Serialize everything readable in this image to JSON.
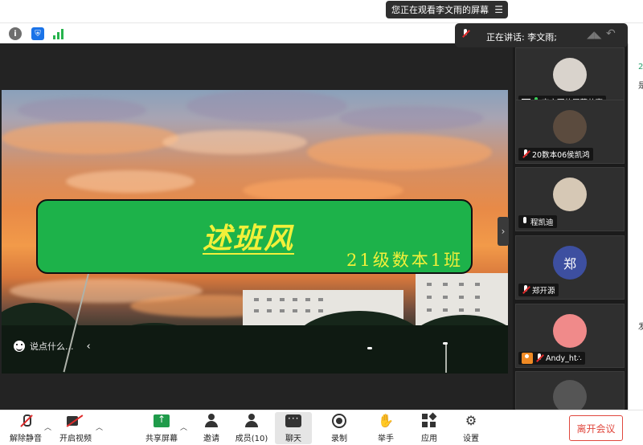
{
  "banner": {
    "viewing_text": "您正在观看李文雨的屏幕",
    "menu_icon": "hamburger-icon"
  },
  "speaking": {
    "label": "正在讲话: 李文雨;"
  },
  "slide": {
    "title": "述班风",
    "subtitle": "21级数本1班"
  },
  "chat_input": {
    "placeholder": "说点什么..."
  },
  "participants": [
    {
      "name": "李文雨的屏幕共享",
      "status": "sharing-mic-on",
      "avatar_color": "#d9d3cc"
    },
    {
      "name": "20数本06侯凯鸿",
      "status": "muted",
      "avatar_color": "#5b4b3e"
    },
    {
      "name": "程凯迪",
      "status": "mic",
      "avatar_color": "#d6c8b5"
    },
    {
      "name": "郑开源",
      "status": "muted",
      "avatar_color": "#3d4fa0",
      "avatar_text": "郑"
    },
    {
      "name": "Andy_ht∴",
      "status": "muted-host",
      "avatar_color": "#f08a8a"
    },
    {
      "name": "",
      "status": "",
      "avatar_color": "#555555"
    }
  ],
  "right_edge": {
    "t1": "2",
    "t2": "是",
    "t3": "发"
  },
  "toolbar": {
    "unmute": "解除静音",
    "start_video": "开启视频",
    "share_screen": "共享屏幕",
    "invite": "邀请",
    "members": "成员(10)",
    "chat": "聊天",
    "record": "录制",
    "raise_hand": "举手",
    "apps": "应用",
    "settings": "设置",
    "leave": "离开会议"
  }
}
